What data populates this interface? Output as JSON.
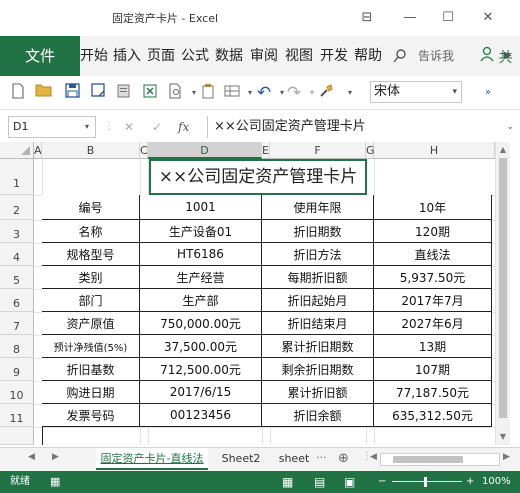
{
  "window": {
    "title": "固定资产卡片 - Excel",
    "minimize": "—",
    "maximize": "☐",
    "close": "✕",
    "ribbon_display": "⊟"
  },
  "ribbon": {
    "file": "文件",
    "tabs": [
      "开始",
      "插入",
      "页面",
      "公式",
      "数据",
      "审阅",
      "视图",
      "开发",
      "帮助"
    ],
    "tell_me": "告诉我",
    "share": "共"
  },
  "qat": {
    "font_name": "宋体"
  },
  "formula_bar": {
    "name_box": "D1",
    "cancel": "✕",
    "enter": "✓",
    "fx": "fx",
    "formula": "××公司固定资产管理卡片"
  },
  "grid": {
    "columns": [
      "A",
      "B",
      "C",
      "D",
      "E",
      "F",
      "G",
      "H"
    ],
    "rows": [
      "1",
      "2",
      "3",
      "4",
      "5",
      "6",
      "7",
      "8",
      "9",
      "10",
      "11"
    ],
    "title": "××公司固定资产管理卡片",
    "table": [
      [
        "编号",
        "1001",
        "使用年限",
        "10年"
      ],
      [
        "名称",
        "生产设备01",
        "折旧期数",
        "120期"
      ],
      [
        "规格型号",
        "HT6186",
        "折旧方法",
        "直线法"
      ],
      [
        "类别",
        "生产经营",
        "每期折旧额",
        "5,937.50元"
      ],
      [
        "部门",
        "生产部",
        "折旧起始月",
        "2017年7月"
      ],
      [
        "资产原值",
        "750,000.00元",
        "折旧结束月",
        "2027年6月"
      ],
      [
        "预计净残值(5%)",
        "37,500.00元",
        "累计折旧期数",
        "13期"
      ],
      [
        "折旧基数",
        "712,500.00元",
        "剩余折旧期数",
        "107期"
      ],
      [
        "购进日期",
        "2017/6/15",
        "累计折旧额",
        "77,187.50元"
      ],
      [
        "发票号码",
        "00123456",
        "折旧余额",
        "635,312.50元"
      ]
    ]
  },
  "sheets": {
    "tabs": [
      "固定资产卡片-直线法",
      "Sheet2",
      "sheet"
    ],
    "more": "···",
    "add": "⊕"
  },
  "status": {
    "ready": "就绪",
    "zoom": "100%",
    "zoom_minus": "−",
    "zoom_plus": "+"
  },
  "colors": {
    "accent": "#217346"
  }
}
